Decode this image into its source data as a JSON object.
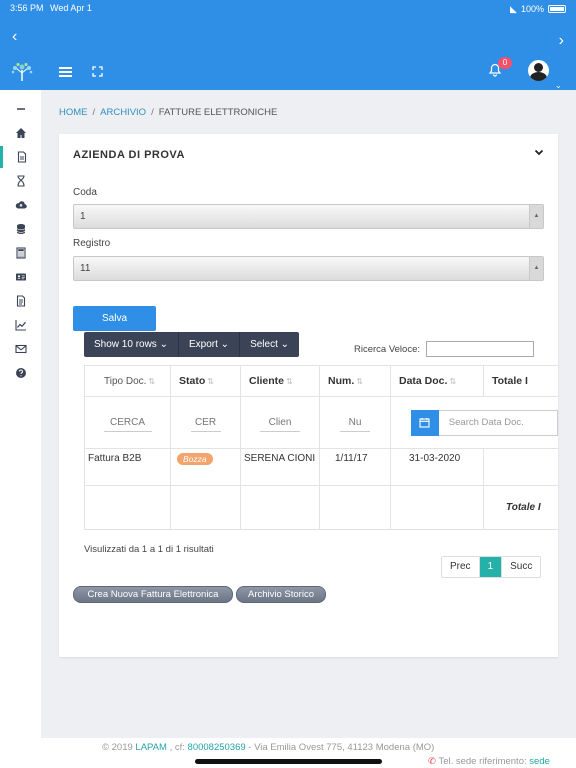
{
  "status": {
    "time": "3:56 PM",
    "date": "Wed Apr 1",
    "battery": "100%"
  },
  "header": {
    "notification_count": "0"
  },
  "breadcrumb": [
    "HOME",
    "ARCHIVIO",
    "FATTURE ELETTRONICHE"
  ],
  "card": {
    "title": "AZIENDA DI PROVA",
    "coda_label": "Coda",
    "coda_value": "1",
    "registro_label": "Registro",
    "registro_value": "11",
    "save_label": "Salva"
  },
  "datatable": {
    "buttons": [
      "Show 10 rows",
      "Export",
      "Select"
    ],
    "search_label": "Ricerca Veloce:",
    "columns": [
      "Tipo Doc.",
      "Stato",
      "Cliente",
      "Num.",
      "Data Doc.",
      "Totale I"
    ],
    "filters": {
      "tipo": "CERCA",
      "stato": "CER",
      "cliente": "Clien",
      "num": "Nu",
      "data": "Search Data Doc."
    },
    "rows": [
      {
        "tipo": "Fattura B2B",
        "stato": "Bozza",
        "cliente": "SERENA CIONI",
        "num": "1/11/17",
        "data": "31-03-2020"
      }
    ],
    "total_label": "Totale I",
    "info": "Visulizzati da 1 a 1 di 1 risultati",
    "pager": {
      "prev": "Prec",
      "current": "1",
      "next": "Succ"
    }
  },
  "actions": {
    "new_invoice": "Crea Nuova Fattura Elettronica",
    "archive": "Archivio Storico"
  },
  "footer": {
    "copyright": "© 2019",
    "company": "LAPAM",
    "cf_label": ", cf:",
    "cf": "80008250369",
    "address": "- Via Emilia Ovest 775, 41123 Modena (MO)",
    "ref_label": "Tel. sede riferimento:",
    "ref_link": "sede"
  },
  "colors": {
    "primary": "#2f8fe6",
    "accent": "#24b1aa",
    "dark": "#3a4456",
    "badge": "#f4a36b"
  }
}
